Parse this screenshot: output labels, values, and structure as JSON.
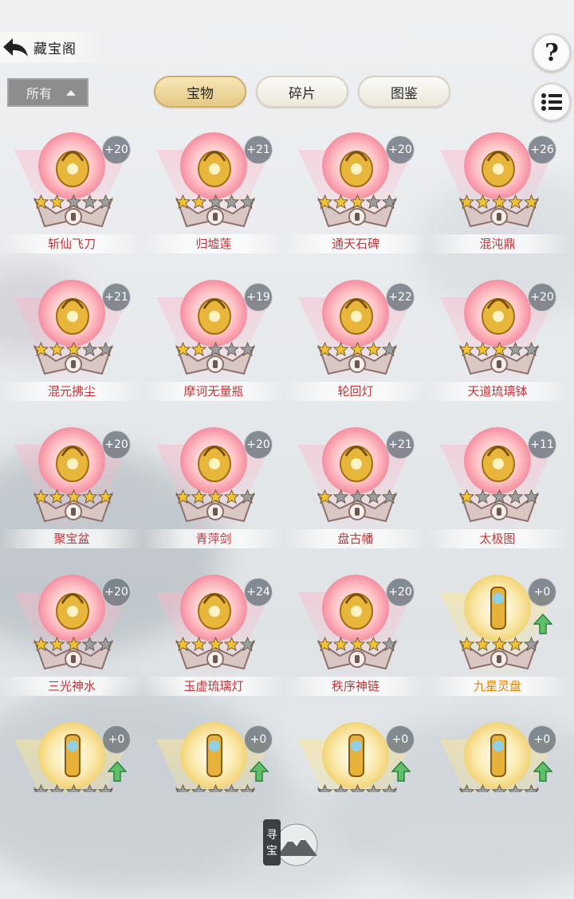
{
  "header": {
    "title": "藏宝阁",
    "filter_label": "所有",
    "tabs": [
      {
        "label": "宝物",
        "active": true
      },
      {
        "label": "碎片",
        "active": false
      },
      {
        "label": "图鉴",
        "active": false
      }
    ],
    "help_label": "?"
  },
  "items": [
    {
      "name": "斩仙飞刀",
      "bonus": "+20",
      "stars": 2,
      "quality": "red",
      "upgradable": false,
      "icon": "flying-blade-icon"
    },
    {
      "name": "归墟莲",
      "bonus": "+21",
      "stars": 2,
      "quality": "red",
      "upgradable": false,
      "icon": "lotus-icon"
    },
    {
      "name": "通天石碑",
      "bonus": "+20",
      "stars": 3,
      "quality": "red",
      "upgradable": false,
      "icon": "stone-tablet-icon"
    },
    {
      "name": "混沌鼎",
      "bonus": "+26",
      "stars": 5,
      "quality": "red",
      "upgradable": false,
      "icon": "cauldron-icon"
    },
    {
      "name": "混元拂尘",
      "bonus": "+21",
      "stars": 3,
      "quality": "red",
      "upgradable": false,
      "icon": "whisk-icon"
    },
    {
      "name": "摩诃无量瓶",
      "bonus": "+19",
      "stars": 2,
      "quality": "red",
      "upgradable": false,
      "icon": "gourd-vase-icon"
    },
    {
      "name": "轮回灯",
      "bonus": "+22",
      "stars": 4,
      "quality": "red",
      "upgradable": false,
      "icon": "lamp-icon"
    },
    {
      "name": "天道琉璃钵",
      "bonus": "+20",
      "stars": 3,
      "quality": "red",
      "upgradable": false,
      "icon": "glass-bowl-icon"
    },
    {
      "name": "聚宝盆",
      "bonus": "+20",
      "stars": 5,
      "quality": "red",
      "upgradable": false,
      "icon": "treasure-bowl-icon"
    },
    {
      "name": "青萍剑",
      "bonus": "+20",
      "stars": 4,
      "quality": "red",
      "upgradable": false,
      "icon": "sword-icon"
    },
    {
      "name": "盘古幡",
      "bonus": "+21",
      "stars": 1,
      "quality": "red",
      "upgradable": false,
      "icon": "banner-icon"
    },
    {
      "name": "太极图",
      "bonus": "+11",
      "stars": 1,
      "quality": "red",
      "upgradable": false,
      "icon": "scroll-icon"
    },
    {
      "name": "三光神水",
      "bonus": "+20",
      "stars": 3,
      "quality": "red",
      "upgradable": false,
      "icon": "water-vase-icon"
    },
    {
      "name": "玉虚琉璃灯",
      "bonus": "+24",
      "stars": 4,
      "quality": "red",
      "upgradable": false,
      "icon": "jade-lamp-icon"
    },
    {
      "name": "秩序神链",
      "bonus": "+20",
      "stars": 4,
      "quality": "red",
      "upgradable": false,
      "icon": "chain-icon"
    },
    {
      "name": "九星灵盘",
      "bonus": "+0",
      "stars": 4,
      "quality": "gold",
      "upgradable": true,
      "icon": "star-disc-icon"
    },
    {
      "name": "",
      "bonus": "+0",
      "stars": 0,
      "quality": "gold",
      "upgradable": true,
      "icon": "dragon-seal-icon"
    },
    {
      "name": "",
      "bonus": "+0",
      "stars": 0,
      "quality": "gold",
      "upgradable": true,
      "icon": "golden-staff-icon"
    },
    {
      "name": "",
      "bonus": "+0",
      "stars": 0,
      "quality": "gold",
      "upgradable": true,
      "icon": "twin-swords-icon"
    },
    {
      "name": "",
      "bonus": "+0",
      "stars": 0,
      "quality": "gold",
      "upgradable": true,
      "icon": "spear-icon"
    }
  ],
  "seek_button": {
    "label": "寻宝"
  },
  "colors": {
    "name_red": "#c0363a",
    "name_gold": "#d8860b",
    "star_filled": "#f2c230",
    "star_empty": "#9a9ea6"
  }
}
